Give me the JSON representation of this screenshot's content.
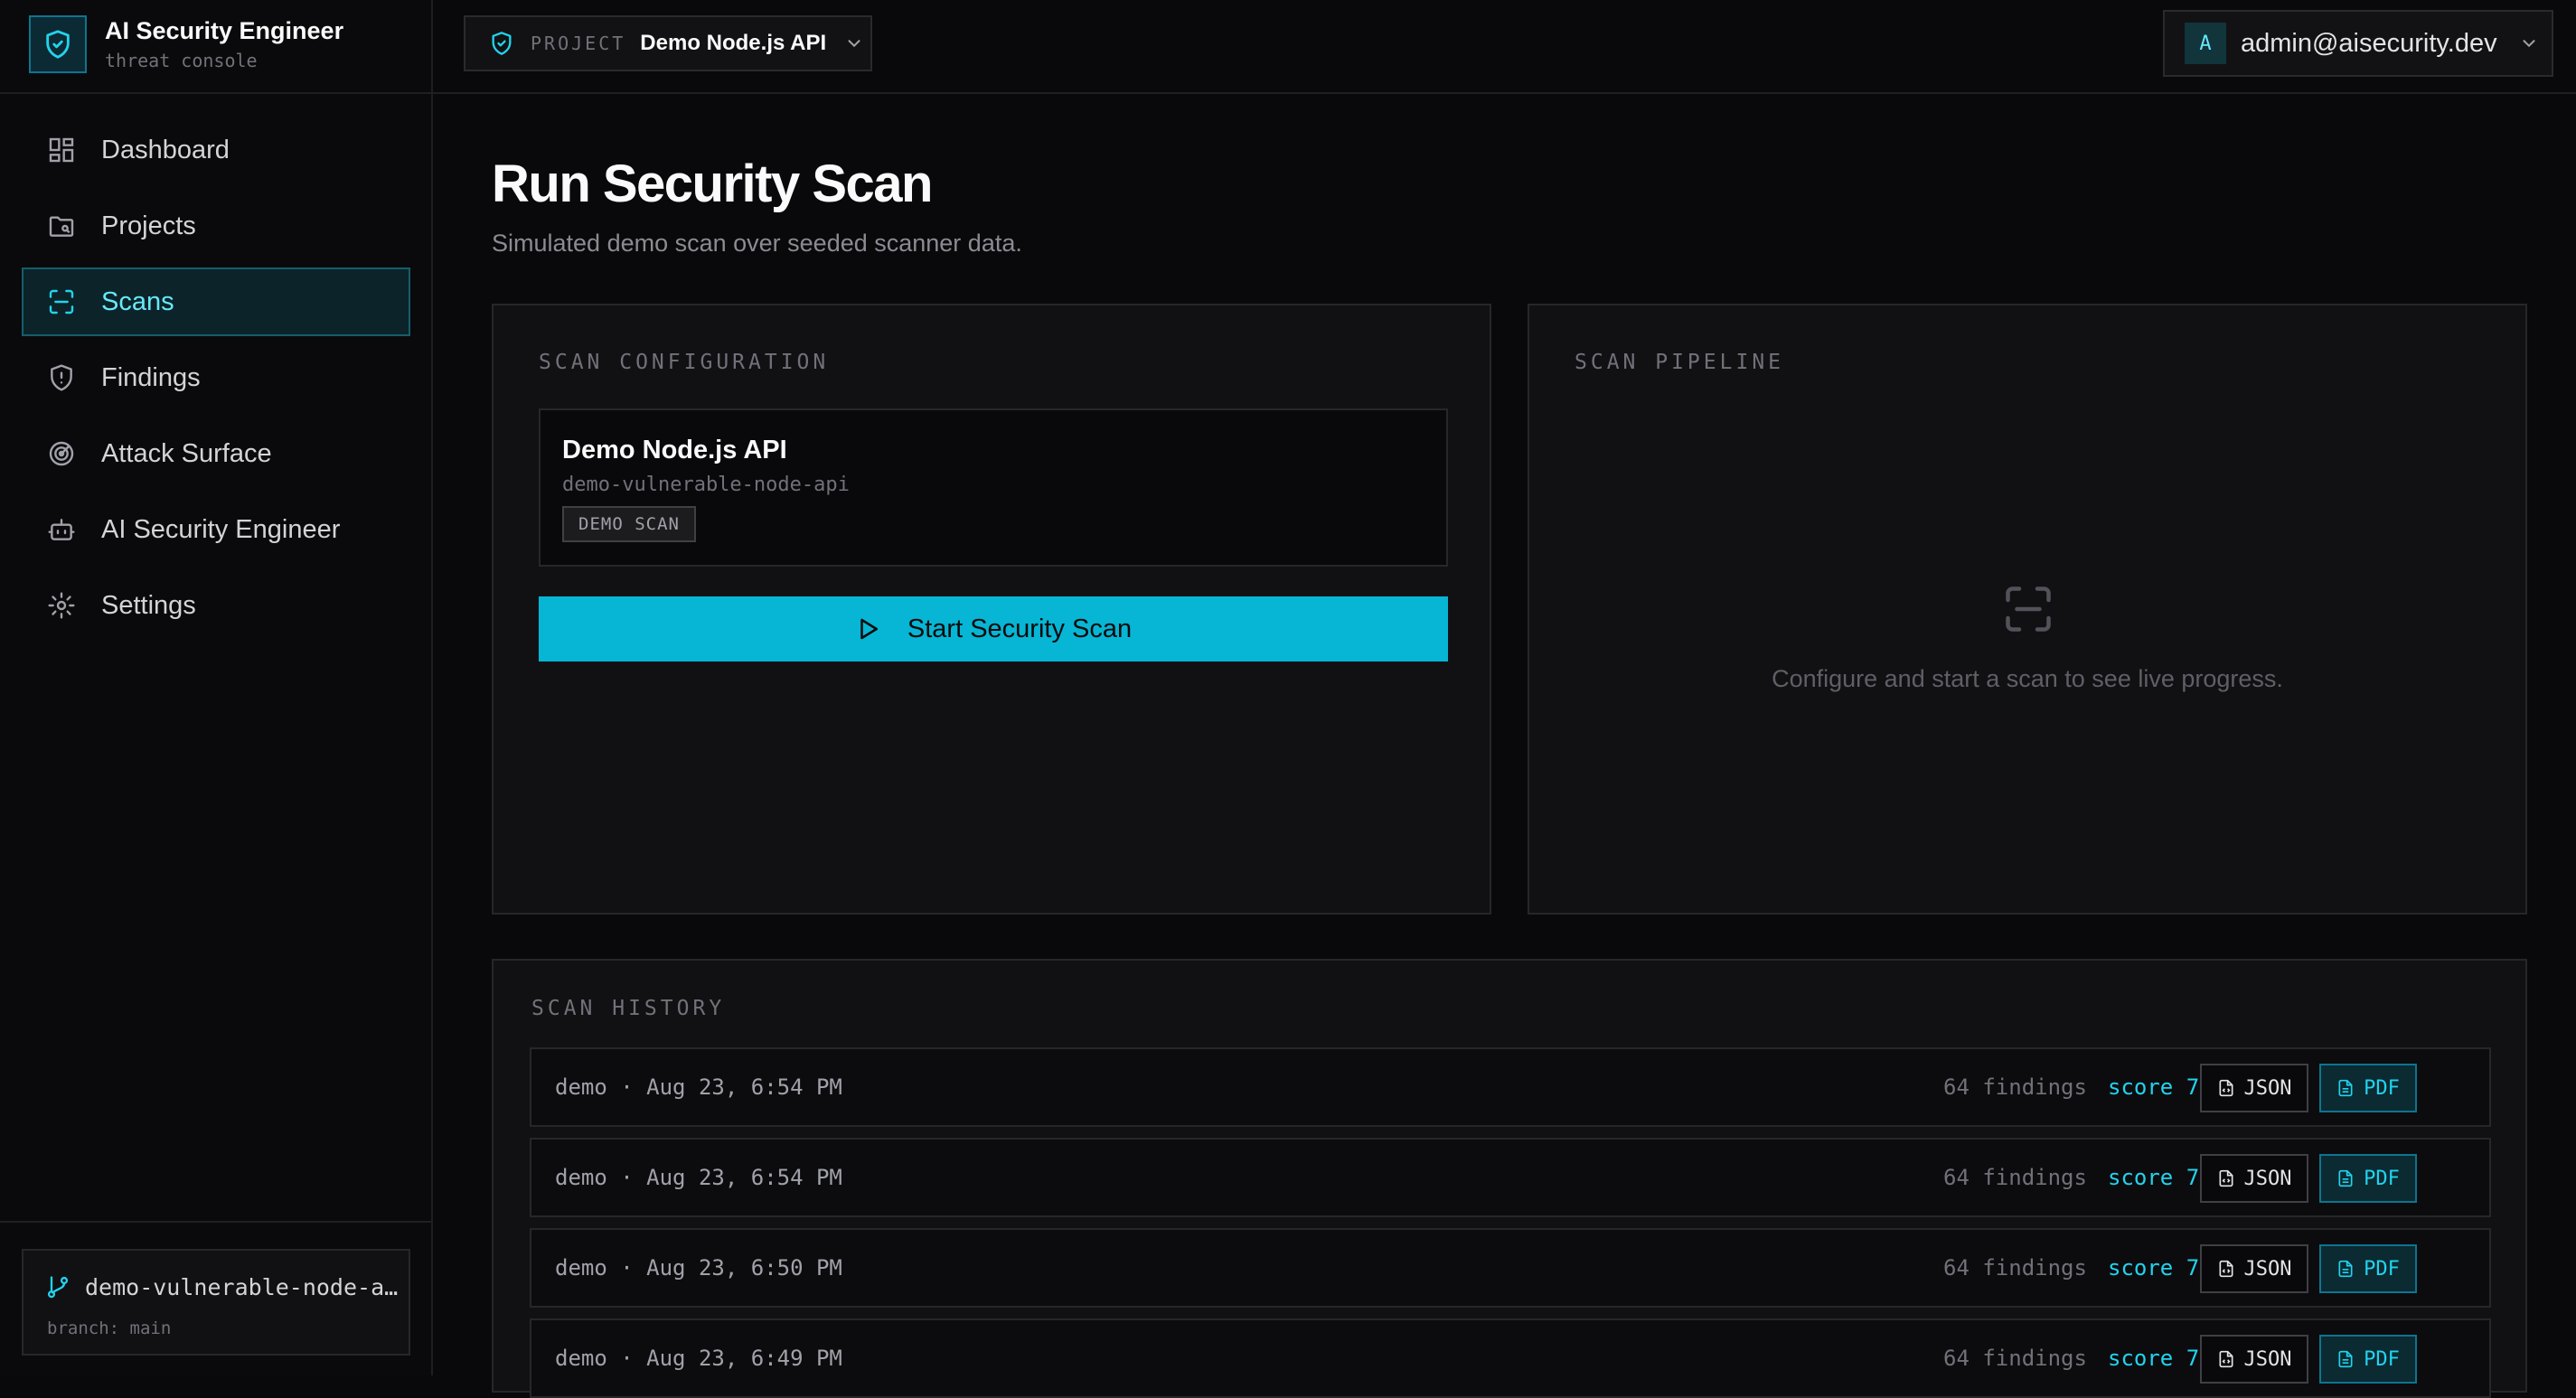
{
  "brand": {
    "title": "AI Security Engineer",
    "subtitle": "threat console"
  },
  "topbar": {
    "project_key": "PROJECT",
    "project_value": "Demo Node.js API",
    "user_initial": "A",
    "user_email": "admin@aisecurity.dev"
  },
  "sidebar": {
    "active": "Scans",
    "items": [
      {
        "label": "Dashboard",
        "icon": "dashboard-icon"
      },
      {
        "label": "Projects",
        "icon": "folder-icon"
      },
      {
        "label": "Scans",
        "icon": "scan-icon"
      },
      {
        "label": "Findings",
        "icon": "shield-alert-icon"
      },
      {
        "label": "Attack Surface",
        "icon": "radar-icon"
      },
      {
        "label": "AI Security Engineer",
        "icon": "bot-icon"
      },
      {
        "label": "Settings",
        "icon": "gear-icon"
      }
    ],
    "repo": {
      "name": "demo-vulnerable-node-a…",
      "branch": "branch: main"
    }
  },
  "page": {
    "title": "Run Security Scan",
    "subtitle": "Simulated demo scan over seeded scanner data."
  },
  "config": {
    "heading": "SCAN CONFIGURATION",
    "project_name": "Demo Node.js API",
    "project_slug": "demo-vulnerable-node-api",
    "badge": "DEMO SCAN",
    "start_label": "Start Security Scan"
  },
  "pipeline": {
    "heading": "SCAN PIPELINE",
    "empty_text": "Configure and start a scan to see live progress."
  },
  "history": {
    "heading": "SCAN HISTORY",
    "json_label": "JSON",
    "pdf_label": "PDF",
    "rows": [
      {
        "when": "demo · Aug 23, 6:54 PM",
        "findings": "64 findings",
        "score": "score 72"
      },
      {
        "when": "demo · Aug 23, 6:54 PM",
        "findings": "64 findings",
        "score": "score 72"
      },
      {
        "when": "demo · Aug 23, 6:50 PM",
        "findings": "64 findings",
        "score": "score 72"
      },
      {
        "when": "demo · Aug 23, 6:49 PM",
        "findings": "64 findings",
        "score": "score 72"
      }
    ]
  },
  "colors": {
    "accent": "#06b6d4",
    "accent_text": "#22d3ee",
    "background": "#09090b",
    "panel": "#111113"
  }
}
